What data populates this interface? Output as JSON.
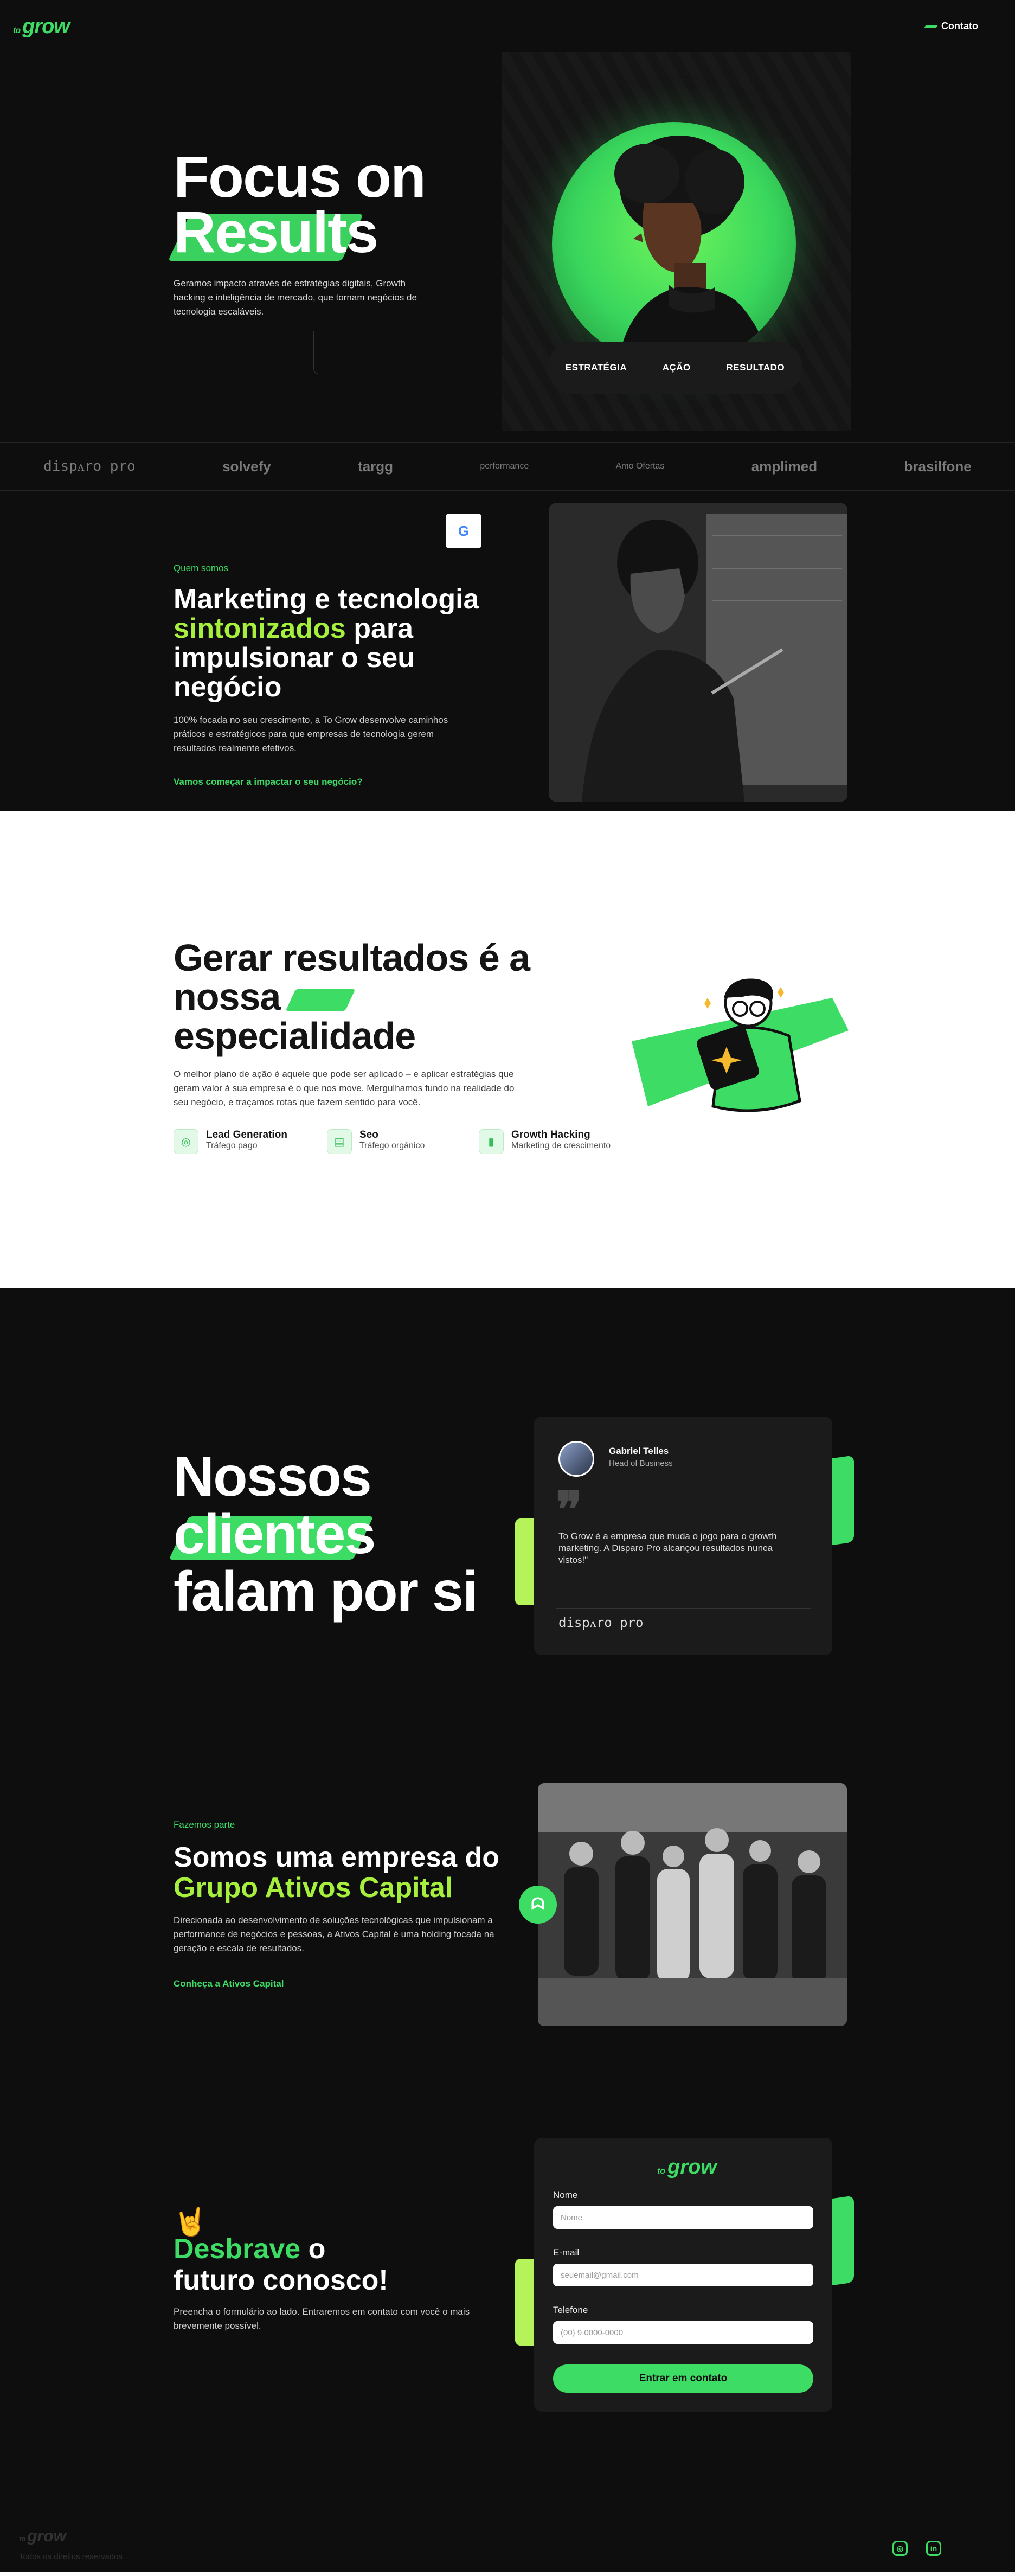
{
  "header": {
    "logo_prefix": "to",
    "logo_main": "grow",
    "contact_label": "Contato"
  },
  "hero": {
    "title_line1": "Focus on",
    "title_line2": "Results",
    "subtitle": "Geramos impacto através de estratégias digitais, Growth hacking e inteligência de mercado, que tornam negócios de tecnologia escaláveis.",
    "tabs": [
      "ESTRATÉGIA",
      "AÇÃO",
      "RESULTADO"
    ]
  },
  "logos": [
    "dispᴧro pro",
    "solvefy",
    "targg",
    "performance",
    "Amo Ofertas",
    "amplimed",
    "brasilfone"
  ],
  "about": {
    "badge": "G",
    "eyebrow": "Quem somos",
    "title_a": "Marketing e tecnologia",
    "title_highlight": "sintonizados",
    "title_b": "para impulsionar o seu negócio",
    "text": "100% focada no seu crescimento, a To Grow desenvolve caminhos práticos e estratégicos para que empresas de tecnologia gerem resultados realmente efetivos.",
    "link": "Vamos começar a impactar o seu negócio?"
  },
  "specialty": {
    "title_line1": "Gerar resultados é a",
    "title_line2": "nossa",
    "title_line3": "especialidade",
    "text": "O melhor plano de ação é aquele que pode ser aplicado – e aplicar estratégias que geram valor à sua empresa é o que nos move. Mergulhamos fundo na realidade do seu negócio, e traçamos rotas que fazem sentido para você.",
    "features": [
      {
        "icon": "target-icon",
        "title": "Lead Generation",
        "subtitle": "Tráfego pago"
      },
      {
        "icon": "chart-icon",
        "title": "Seo",
        "subtitle": "Tráfego orgânico"
      },
      {
        "icon": "bolt-icon",
        "title": "Growth Hacking",
        "subtitle": "Marketing de crescimento"
      }
    ]
  },
  "testimonials": {
    "title_line1": "Nossos",
    "title_line2": "clientes",
    "title_line3": "falam por si",
    "name": "Gabriel Telles",
    "role": "Head of Business",
    "quote": "To Grow é a empresa que muda o jogo para o growth marketing. A Disparo Pro alcançou resultados nunca vistos!\"",
    "company": "dispᴧro pro"
  },
  "group": {
    "eyebrow": "Fazemos parte",
    "title_line1": "Somos uma empresa do",
    "title_line2": "Grupo Ativos Capital",
    "text": "Direcionada ao desenvolvimento de soluções tecnológicas que impulsionam a performance de negócios e pessoas, a Ativos Capital é uma holding focada na geração e escala de resultados.",
    "link": "Conheça a Ativos Capital"
  },
  "contact": {
    "emoji": "🤘",
    "title_highlight": "Desbrave",
    "title_a": "o",
    "title_line2": "futuro conosco!",
    "text": "Preencha o formulário ao lado. Entraremos em contato com você o mais brevemente possível.",
    "form": {
      "name_label": "Nome",
      "name_placeholder": "Nome",
      "email_label": "E-mail",
      "email_placeholder": "seuemail@gmail.com",
      "phone_label": "Telefone",
      "phone_placeholder": "(00) 9 0000-0000",
      "submit": "Entrar em contato"
    }
  },
  "footer": {
    "copyright": "Todos os direitos reservados",
    "social": [
      "instagram-icon",
      "linkedin-icon"
    ]
  },
  "colors": {
    "brand_green": "#3ddc64",
    "lime": "#a6ef3c",
    "background": "#0e0e0e"
  }
}
